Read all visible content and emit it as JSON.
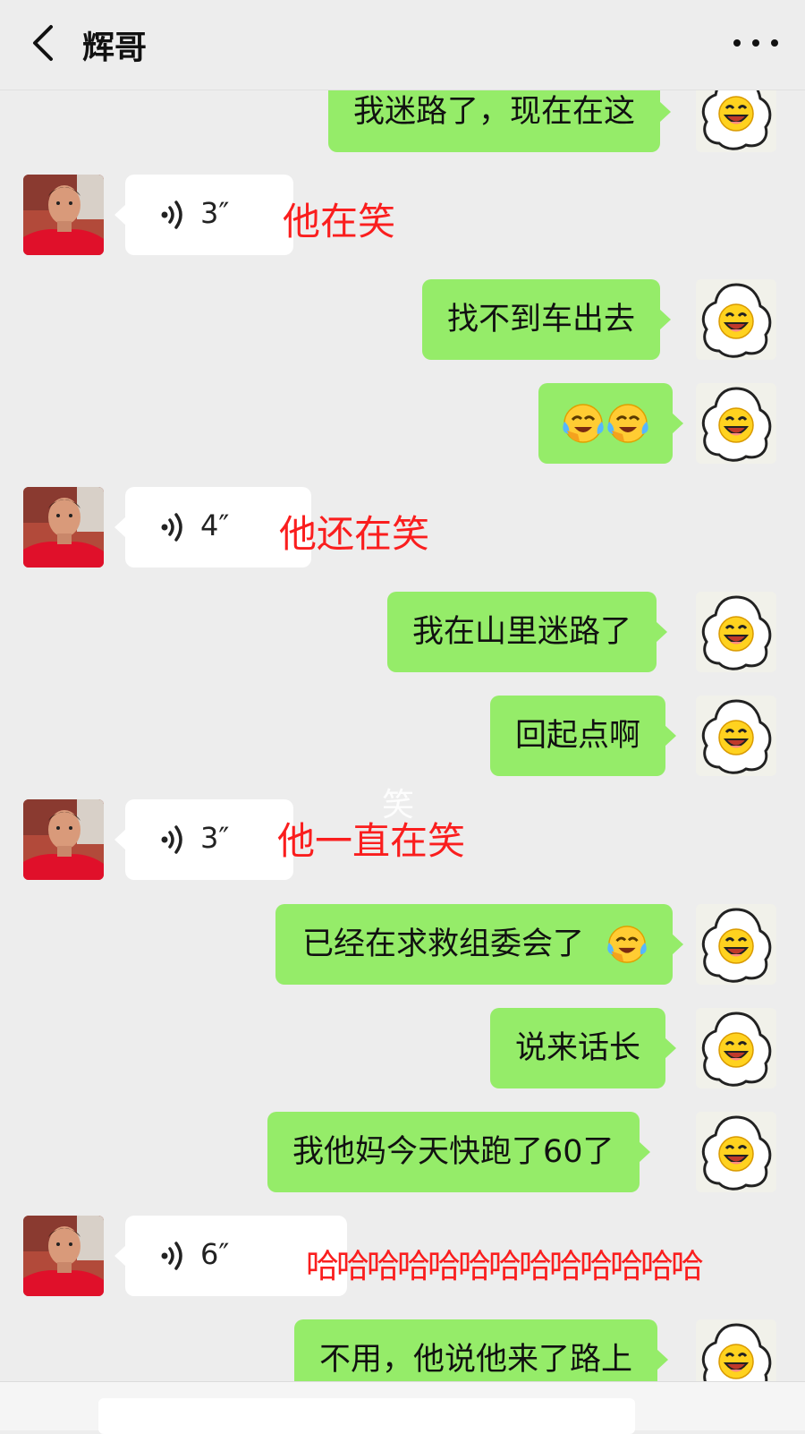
{
  "header": {
    "title": "辉哥"
  },
  "messages": [
    {
      "side": "out",
      "text": "我迷路了，现在在这"
    },
    {
      "side": "in",
      "duration": "3″",
      "annotation": "他在笑"
    },
    {
      "side": "out",
      "text": "找不到车出去"
    },
    {
      "side": "out",
      "text": "",
      "emoji": "laugh-cry-emoji x2"
    },
    {
      "side": "in",
      "duration": "4″",
      "annotation": "他还在笑"
    },
    {
      "side": "out",
      "text": "我在山里迷路了"
    },
    {
      "side": "out",
      "text": "回起点啊"
    },
    {
      "side": "in",
      "duration": "3″",
      "annotation": "他一直在笑"
    },
    {
      "side": "out",
      "text": "已经在求救组委会了",
      "emoji": "laugh-cry-emoji"
    },
    {
      "side": "out",
      "text": "说来话长"
    },
    {
      "side": "out",
      "text": "我他妈今天快跑了60了"
    },
    {
      "side": "in",
      "duration": "6″",
      "annotation": "哈哈哈哈哈哈哈哈哈哈哈哈哈"
    },
    {
      "side": "out",
      "text": "不用，他说他来了路上"
    }
  ],
  "watermark": "笑",
  "colors": {
    "outgoing_bubble": "#95ec69",
    "incoming_bubble": "#ffffff",
    "annotation": "#fa1e1e",
    "background": "#ededed"
  }
}
